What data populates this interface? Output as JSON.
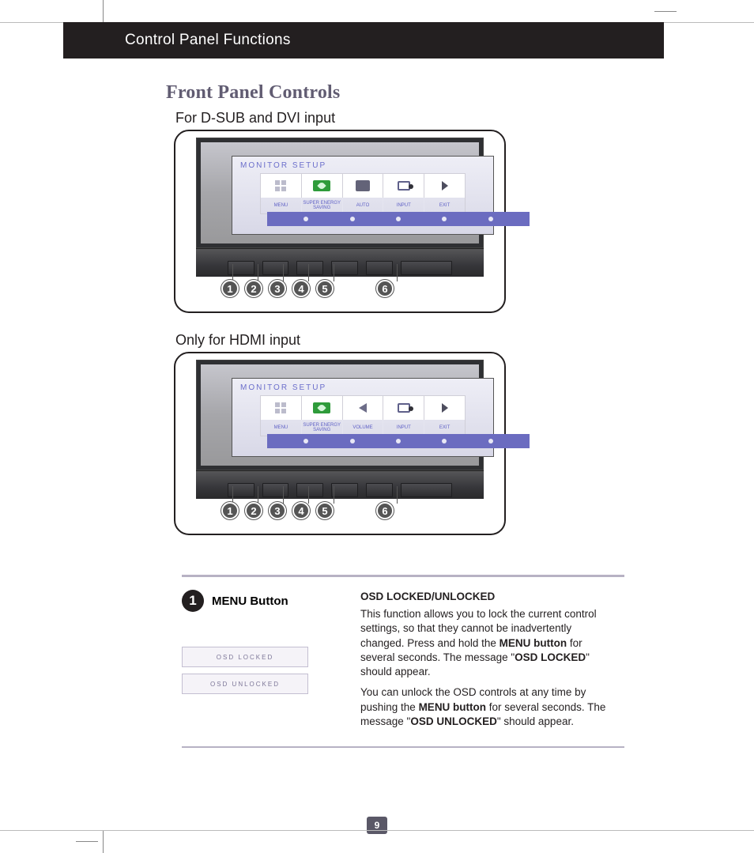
{
  "header": {
    "title": "Control Panel Functions"
  },
  "section_title": "Front Panel Controls",
  "panel1": {
    "caption": "For D-SUB and DVI input",
    "osd_title": "MONITOR SETUP",
    "labels": [
      "MENU",
      "SUPER ENERGY SAVING",
      "AUTO",
      "INPUT",
      "EXIT"
    ],
    "callouts": [
      "1",
      "2",
      "3",
      "4",
      "5",
      "6"
    ]
  },
  "panel2": {
    "caption": "Only for HDMI input",
    "osd_title": "MONITOR SETUP",
    "labels": [
      "MENU",
      "SUPER ENERGY SAVING",
      "VOLUME",
      "INPUT",
      "EXIT"
    ],
    "callouts": [
      "1",
      "2",
      "3",
      "4",
      "5",
      "6"
    ]
  },
  "item1": {
    "number": "1",
    "title": "MENU Button",
    "status_locked": "OSD LOCKED",
    "status_unlocked": "OSD UNLOCKED",
    "heading": "OSD LOCKED/UNLOCKED",
    "p1a": "This function allows you to lock the current control settings, so that they cannot be inadvertently changed. Press and hold the ",
    "p1b": "MENU button",
    "p1c": " for several seconds. The message \"",
    "p1d": "OSD LOCKED",
    "p1e": "\" should appear.",
    "p2a": "You can unlock the OSD controls at any time by pushing the ",
    "p2b": "MENU button",
    "p2c": " for several seconds. The message \"",
    "p2d": "OSD UNLOCKED",
    "p2e": "\" should appear."
  },
  "page_number": "9"
}
